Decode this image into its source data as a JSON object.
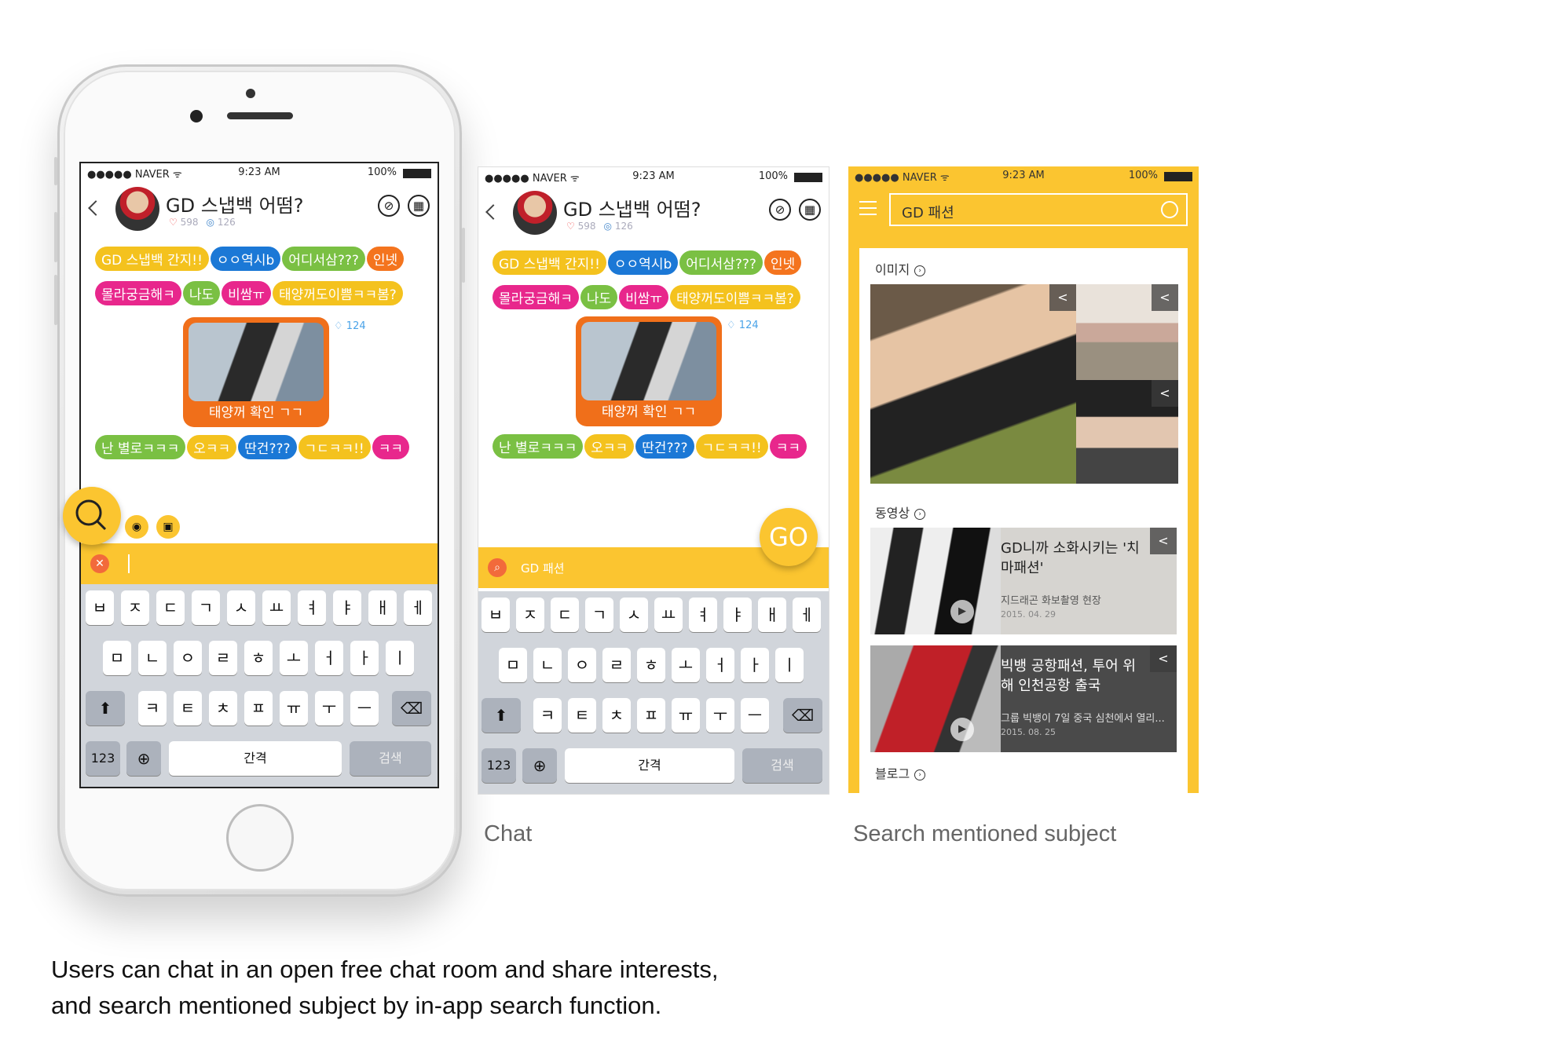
{
  "status": {
    "carrier": "●●●●● NAVER ᯤ",
    "time": "9:23 AM",
    "battery": "100%"
  },
  "chat": {
    "room_title": "GD 스냅백 어떰?",
    "likes": "598",
    "members": "126",
    "bubbles_row1": [
      "GD 스냅백 간지!!",
      "ㅇㅇ역시b",
      "어디서삼???",
      "인넷"
    ],
    "bubbles_row2": [
      "몰라궁금해ㅋ",
      "나도",
      "비쌈ㅠ",
      "태양꺼도이쁨ㅋㅋ봄?"
    ],
    "image_caption": "태양꺼 확인 ㄱㄱ",
    "image_likes": "124",
    "bubbles_row3": [
      "난 별로ㅋㅋㅋ",
      "오ㅋㅋ",
      "딴건???",
      "ㄱㄷㅋㅋ!!",
      "ㅋㅋ"
    ],
    "search_query": "GD 패션",
    "go_label": "GO",
    "bubble_colors": {
      "yellow": "#f4c21e",
      "blue": "#1b78d6",
      "green": "#7ac043",
      "orange": "#f4741e",
      "pink": "#e8278c"
    }
  },
  "keyboard": {
    "row1": [
      "ㅂ",
      "ㅈ",
      "ㄷ",
      "ㄱ",
      "ㅅ",
      "ㅛ",
      "ㅕ",
      "ㅑ",
      "ㅐ",
      "ㅔ"
    ],
    "row2": [
      "ㅁ",
      "ㄴ",
      "ㅇ",
      "ㄹ",
      "ㅎ",
      "ㅗ",
      "ㅓ",
      "ㅏ",
      "ㅣ"
    ],
    "row3": [
      "ㅋ",
      "ㅌ",
      "ㅊ",
      "ㅍ",
      "ㅠ",
      "ㅜ",
      "ㅡ"
    ],
    "shift_icon": "shift-icon",
    "delete_icon": "delete-icon",
    "numbers": "123",
    "globe_icon": "globe-icon",
    "space": "간격",
    "search": "검색"
  },
  "search_result": {
    "query": "GD 패션",
    "section_images": "이미지",
    "section_videos": "동영상",
    "section_blog": "블로그",
    "videos": [
      {
        "title": "GD니까 소화시키는 '치마패션'",
        "subtitle": "지드래곤 화보촬영 현장",
        "date": "2015. 04. 29"
      },
      {
        "title": "빅뱅 공항패션, 투어 위해 인천공항 출국",
        "subtitle": "그룹 빅뱅이 7일 중국 심천에서 열리...",
        "date": "2015. 08. 25"
      }
    ],
    "accent": "#fbc530"
  },
  "captions": {
    "chat": "Chat",
    "search": "Search mentioned subject"
  },
  "description_lines": [
    "Users can chat in an open free chat room and share interests,",
    "and search mentioned subject by in-app search function."
  ]
}
